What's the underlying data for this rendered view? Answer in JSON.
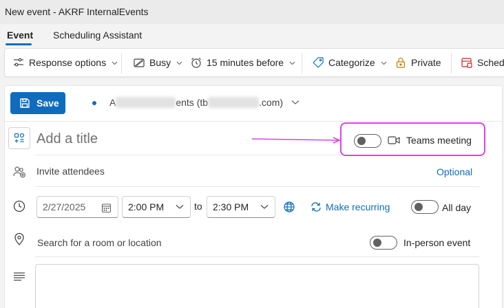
{
  "window": {
    "title": "New event - AKRF InternalEvents"
  },
  "tabs": [
    {
      "label": "Event",
      "active": true
    },
    {
      "label": "Scheduling Assistant",
      "active": false
    }
  ],
  "ribbon": {
    "response_options": "Response options",
    "show_as": "Busy",
    "reminder": "15 minutes before",
    "categorize": "Categorize",
    "private": "Private",
    "scheduling_poll": "Schedu"
  },
  "form": {
    "save_label": "Save",
    "account": {
      "prefix": "A",
      "mid": "ents (tb",
      "suffix": ".com)"
    },
    "title_placeholder": "Add a title",
    "teams_label": "Teams meeting",
    "attendees_placeholder": "Invite attendees",
    "optional_label": "Optional",
    "start_date": "2/27/2025",
    "start_time": "2:00 PM",
    "to_label": "to",
    "end_time": "2:30 PM",
    "make_recurring": "Make recurring",
    "all_day_label": "All day",
    "location_placeholder": "Search for a room or location",
    "in_person_label": "In-person event"
  },
  "colors": {
    "accent": "#0f6cbd",
    "highlight": "#e040e8"
  }
}
